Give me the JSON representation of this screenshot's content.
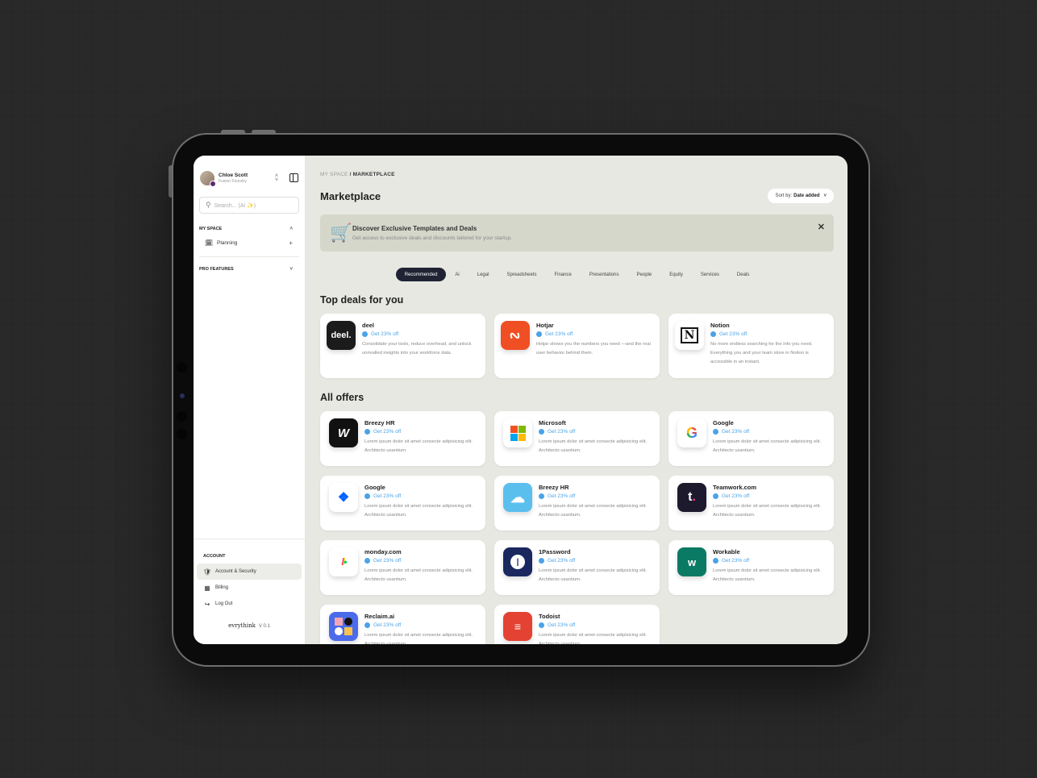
{
  "sidebar": {
    "user": {
      "name": "Chloe Scott",
      "org": "Fusion Foundry"
    },
    "search_placeholder": "Search... (Ai ✨)",
    "my_space": {
      "label": "MY SPACE",
      "items": [
        {
          "label": "Planning",
          "icon": "calendar-edit-icon"
        }
      ]
    },
    "pro_features": {
      "label": "PRO FEATURES"
    },
    "account": {
      "label": "ACCOUNT",
      "items": [
        {
          "label": "Account & Security",
          "icon": "shield-check-icon",
          "active": true
        },
        {
          "label": "Billing",
          "icon": "billing-icon"
        },
        {
          "label": "Log Out",
          "icon": "logout-icon"
        }
      ]
    },
    "brand": "evrythink",
    "version": "V 0.1"
  },
  "main": {
    "breadcrumb": {
      "parent": "MY SPACE",
      "separator": " / ",
      "current": "MARKETPLACE"
    },
    "title": "Marketplace",
    "sort": {
      "label": "Sort by:",
      "value": "Date added"
    },
    "banner": {
      "title": "Discover Exclusive Templates and Deals",
      "subtitle": "Get access to exclusive deals and discounts tailored for your startup."
    },
    "tabs": [
      "Recommended",
      "Ai",
      "Legal",
      "Spreadsheets",
      "Finance",
      "Presentations",
      "People",
      "Equity",
      "Services",
      "Deals"
    ],
    "active_tab": "Recommended",
    "top_deals_title": "Top deals for you",
    "top_deals": [
      {
        "name": "deel",
        "deal": "Get 23% off",
        "desc": "Consolidate your tools, reduce overhead, and unlock unrivalled insights into your workforce data."
      },
      {
        "name": "Hotjar",
        "deal": "Get 23% off",
        "desc": "Hotjar shows you the numbers you need —and the real user behavior behind them."
      },
      {
        "name": "Notion",
        "deal": "Get 23% off",
        "desc": "No more endless searching for the info you need. Everything you and your team store in Notion is accessible in an instant."
      }
    ],
    "all_offers_title": "All offers",
    "offers": [
      {
        "name": "Breezy HR",
        "deal": "Get 23% off",
        "desc": "Lorem ipsum dolor sit amet consecte adipisicing elit. Architecto usantium."
      },
      {
        "name": "Microsoft",
        "deal": "Get 23% off",
        "desc": "Lorem ipsum dolor sit amet consecte adipisicing elit. Architecto usantium."
      },
      {
        "name": "Google",
        "deal": "Get 23% off",
        "desc": "Lorem ipsum dolor sit amet consecte adipisicing elit. Architecto usantium."
      },
      {
        "name": "Google",
        "deal": "Get 23% off",
        "desc": "Lorem ipsum dolor sit amet consecte adipisicing elit. Architecto usantium."
      },
      {
        "name": "Breezy HR",
        "deal": "Get 23% off",
        "desc": "Lorem ipsum dolor sit amet consecte adipisicing elit. Architecto usantium."
      },
      {
        "name": "Teamwork.com",
        "deal": "Get 23% off",
        "desc": "Lorem ipsum dolor sit amet consecte adipisicing elit. Architecto usantium."
      },
      {
        "name": "monday.com",
        "deal": "Get 23% off",
        "desc": "Lorem ipsum dolor sit amet consecte adipisicing elit. Architecto usantium."
      },
      {
        "name": "1Password",
        "deal": "Get 23% off",
        "desc": "Lorem ipsum dolor sit amet consecte adipisicing elit. Architecto usantium."
      },
      {
        "name": "Workable",
        "deal": "Get 23% off",
        "desc": "Lorem ipsum dolor sit amet consecte adipisicing elit. Architecto usantium."
      },
      {
        "name": "Reclaim.ai",
        "deal": "Get 23% off",
        "desc": "Lorem ipsum dolor sit amet consecte adipisicing elit. Architecto usantium."
      },
      {
        "name": "Todoist",
        "deal": "Get 23% off",
        "desc": "Lorem ipsum dolor sit amet consecte adipisicing elit. Architecto usantium."
      }
    ]
  },
  "colors": {
    "accent": "#1f2333",
    "deal_blue": "#4aa3e8",
    "banner_bg": "#d5d7cb",
    "page_bg": "#e8e8e3"
  }
}
